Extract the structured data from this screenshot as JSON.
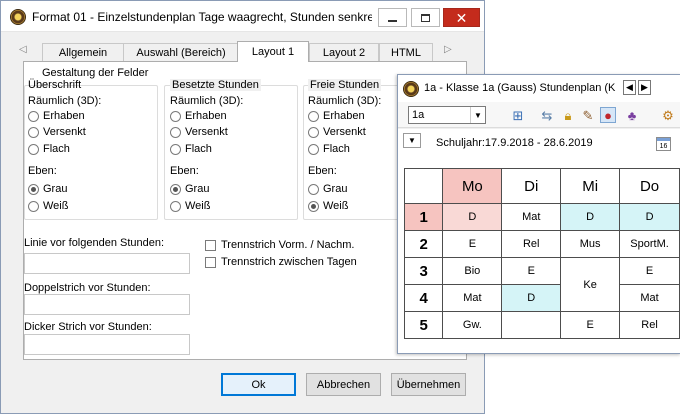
{
  "dialog": {
    "title": "Format 01 - Einzelstundenplan Tage waagrecht, Stunden senkre...",
    "tabs": [
      "Allgemein",
      "Auswahl (Bereich)",
      "Layout 1",
      "Layout 2",
      "HTML"
    ],
    "active_tab": "Layout 1",
    "section_title": "Gestaltung der Felder",
    "groups": [
      {
        "heading": "Überschrift",
        "raum_label": "Räumlich (3D):",
        "raum_options": [
          "Erhaben",
          "Versenkt",
          "Flach"
        ],
        "eben_label": "Eben:",
        "eben_options": [
          "Grau",
          "Weiß"
        ],
        "eben_selected": "Grau"
      },
      {
        "heading": "Besetzte Stunden",
        "raum_label": "Räumlich (3D):",
        "raum_options": [
          "Erhaben",
          "Versenkt",
          "Flach"
        ],
        "eben_label": "Eben:",
        "eben_options": [
          "Grau",
          "Weiß"
        ],
        "eben_selected": "Grau"
      },
      {
        "heading": "Freie Stunden",
        "raum_label": "Räumlich (3D):",
        "raum_options": [
          "Erhaben",
          "Versenkt",
          "Flach"
        ],
        "eben_label": "Eben:",
        "eben_options": [
          "Grau",
          "Weiß"
        ],
        "eben_selected": "Weiß"
      }
    ],
    "fields": {
      "linie_label": "Linie vor folgenden Stunden:",
      "linie_value": "",
      "doppel_label": "Doppelstrich vor Stunden:",
      "doppel_value": "",
      "dicker_label": "Dicker Strich vor Stunden:",
      "dicker_value": ""
    },
    "checkboxes": {
      "trenn_vorm": "Trennstrich Vorm. / Nachm.",
      "trenn_tage": "Trennstrich zwischen Tagen"
    },
    "buttons": {
      "ok": "Ok",
      "abbrechen": "Abbrechen",
      "uebernehmen": "Übernehmen"
    }
  },
  "timetable": {
    "title": "1a - Klasse 1a (Gauss)  Stundenplan  (K",
    "class_select": "1a",
    "schuljahr": "Schuljahr:17.9.2018 - 28.6.2019",
    "days": [
      "Mo",
      "Di",
      "Mi",
      "Do"
    ],
    "periods": [
      "1",
      "2",
      "3",
      "4",
      "5"
    ],
    "cells": {
      "p1": [
        "D",
        "Mat",
        "D",
        "D"
      ],
      "p2": [
        "E",
        "Rel",
        "Mus",
        "SportM."
      ],
      "p3": [
        "Bio",
        "E",
        "Ke",
        "E"
      ],
      "p4": [
        "Mat",
        "D",
        "",
        "Mat"
      ],
      "p5": [
        "Gw.",
        "",
        "E",
        "Rel"
      ]
    },
    "colors": {
      "highlight": "#f6c4c0",
      "cyan": "#d5f4f7",
      "pink": "#f9d9d6"
    }
  }
}
